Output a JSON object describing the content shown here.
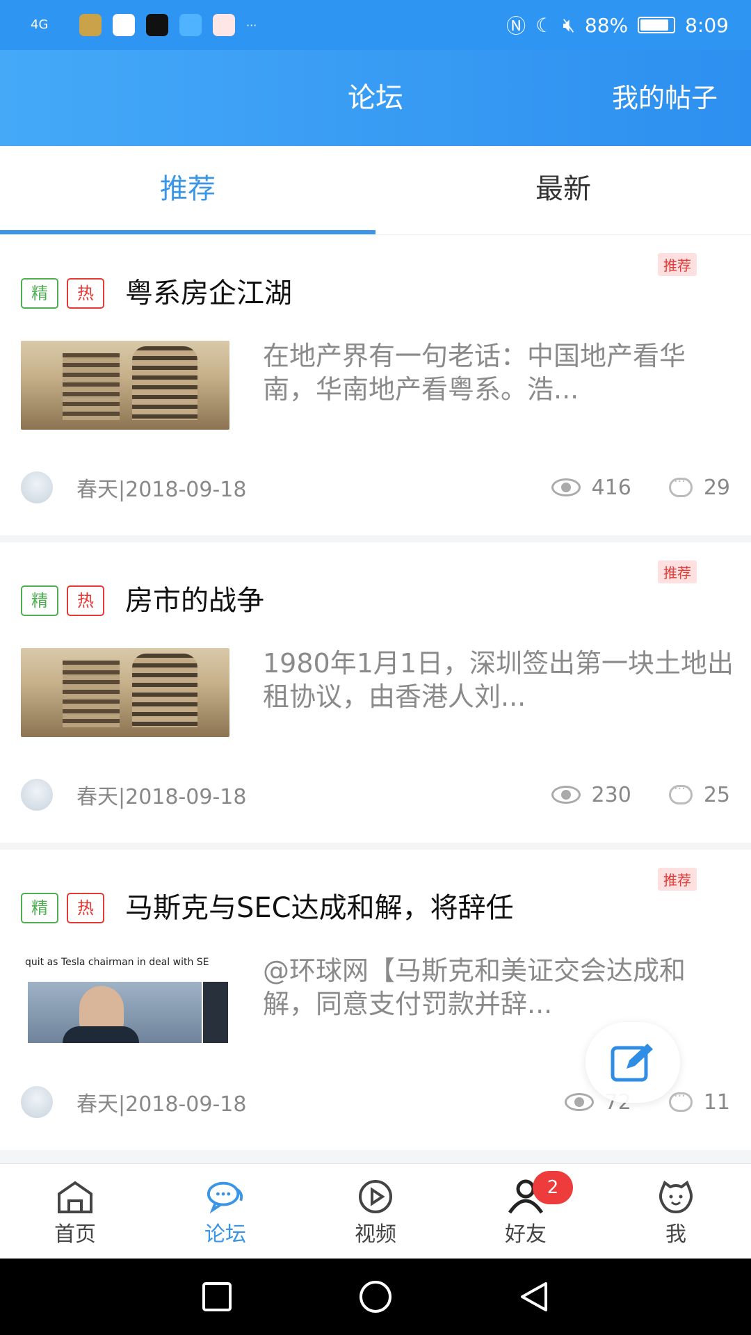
{
  "status_bar": {
    "signal": "4G",
    "battery": "88%",
    "time": "8:09",
    "more": "···"
  },
  "header": {
    "title": "论坛",
    "my_posts": "我的帖子"
  },
  "tabs": [
    {
      "label": "推荐",
      "active": true
    },
    {
      "label": "最新",
      "active": false
    }
  ],
  "posts": [
    {
      "badge": "推荐",
      "tags": [
        "精",
        "热"
      ],
      "title": "粤系房企江湖",
      "summary": "在地产界有一句老话：中国地产看华南，华南地产看粤系。浩...",
      "author_date": "春天|2018-09-18",
      "views": "416",
      "comments": "29"
    },
    {
      "badge": "推荐",
      "tags": [
        "精",
        "热"
      ],
      "title": "房市的战争",
      "summary": "1980年1月1日，深圳签出第一块土地出租协议，由香港人刘...",
      "author_date": "春天|2018-09-18",
      "views": "230",
      "comments": "25"
    },
    {
      "badge": "推荐",
      "tags": [
        "精",
        "热"
      ],
      "title": "马斯克与SEC达成和解，将辞任",
      "thumb_headline": "quit as Tesla chairman in deal with SE",
      "summary": "@环球网【马斯克和美证交会达成和解，同意支付罚款并辞...",
      "author_date": "春天|2018-09-18",
      "views": "72",
      "comments": "11"
    }
  ],
  "tabbar": [
    {
      "label": "首页",
      "icon": "home-icon"
    },
    {
      "label": "论坛",
      "icon": "chat-bubbles-icon",
      "active": true
    },
    {
      "label": "视频",
      "icon": "play-circle-icon"
    },
    {
      "label": "好友",
      "icon": "person-icon",
      "badge": "2"
    },
    {
      "label": "我",
      "icon": "smiley-icon"
    }
  ],
  "colors": {
    "brand": "#2e95f2",
    "active_tab": "#3b95e6",
    "hot_tag": "#e53935",
    "elite_tag": "#4caf50"
  }
}
